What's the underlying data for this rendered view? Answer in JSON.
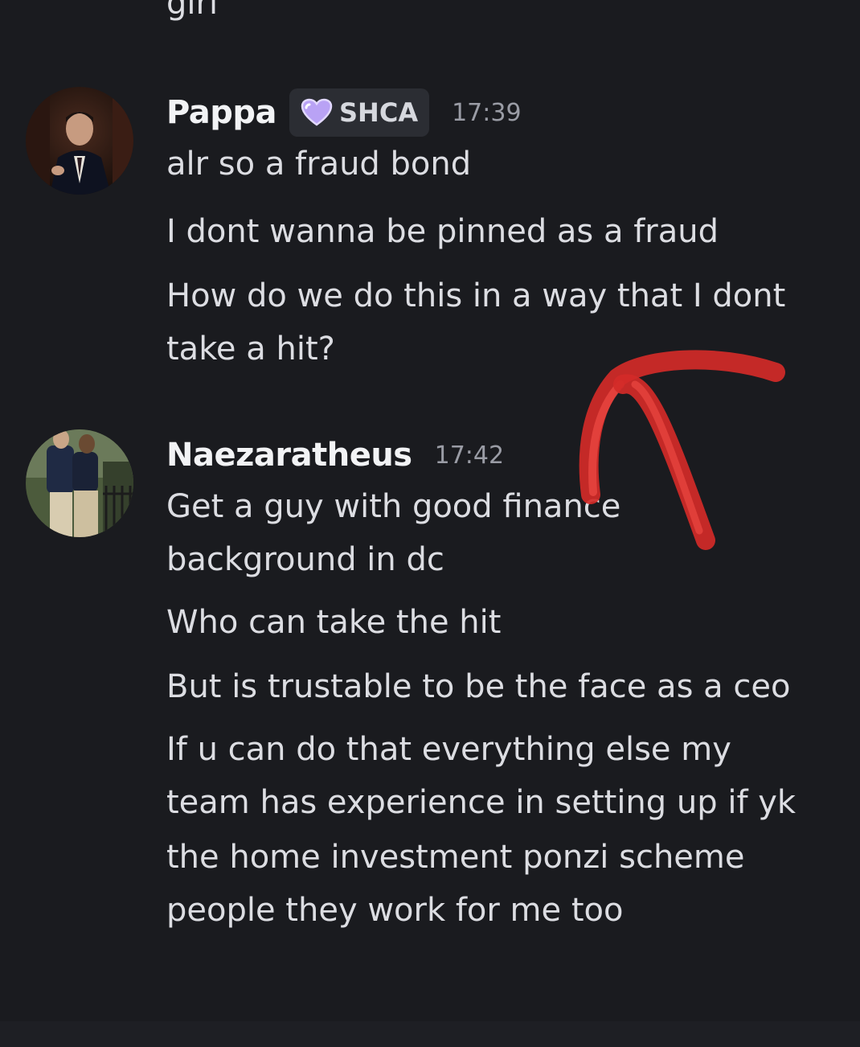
{
  "previous_message": {
    "text": "girl"
  },
  "messages": [
    {
      "username": "Pappa",
      "tag": {
        "icon": "heart-icon",
        "label": "SHCA",
        "color": "#b9a2f5"
      },
      "timestamp": "17:39",
      "lines": [
        "alr so a fraud bond",
        "I dont wanna be pinned as a fraud",
        "How do we do this in a way that I dont",
        "take a hit?"
      ]
    },
    {
      "username": "Naezaratheus",
      "timestamp": "17:42",
      "lines": [
        "Get a guy with good finance",
        "background in dc",
        "Who can take the hit",
        "But is trustable to be the face as a ceo",
        "If u can do that everything else my",
        "team has experience in setting up if yk",
        "the home investment ponzi scheme",
        "people they work for me too"
      ]
    }
  ],
  "colors": {
    "background": "#1a1b1f",
    "text": "#dcdde2",
    "username": "#f2f3f5",
    "timestamp": "#9a9ca5",
    "annotation_arrow": "#e0322f"
  }
}
